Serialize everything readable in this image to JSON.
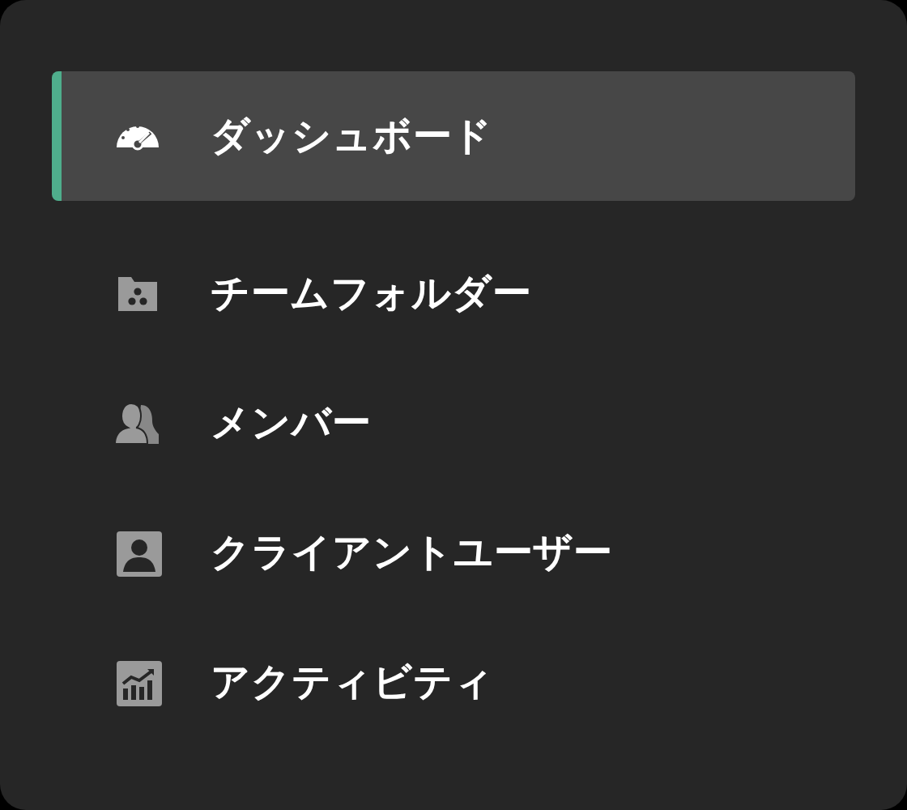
{
  "nav_items": [
    {
      "label": "ダッシュボード",
      "selected": true
    },
    {
      "label": "チームフォルダー",
      "selected": false
    },
    {
      "label": "メンバー",
      "selected": false
    },
    {
      "label": "クライアントユーザー",
      "selected": false
    },
    {
      "label": "アクティビティ",
      "selected": false
    }
  ]
}
